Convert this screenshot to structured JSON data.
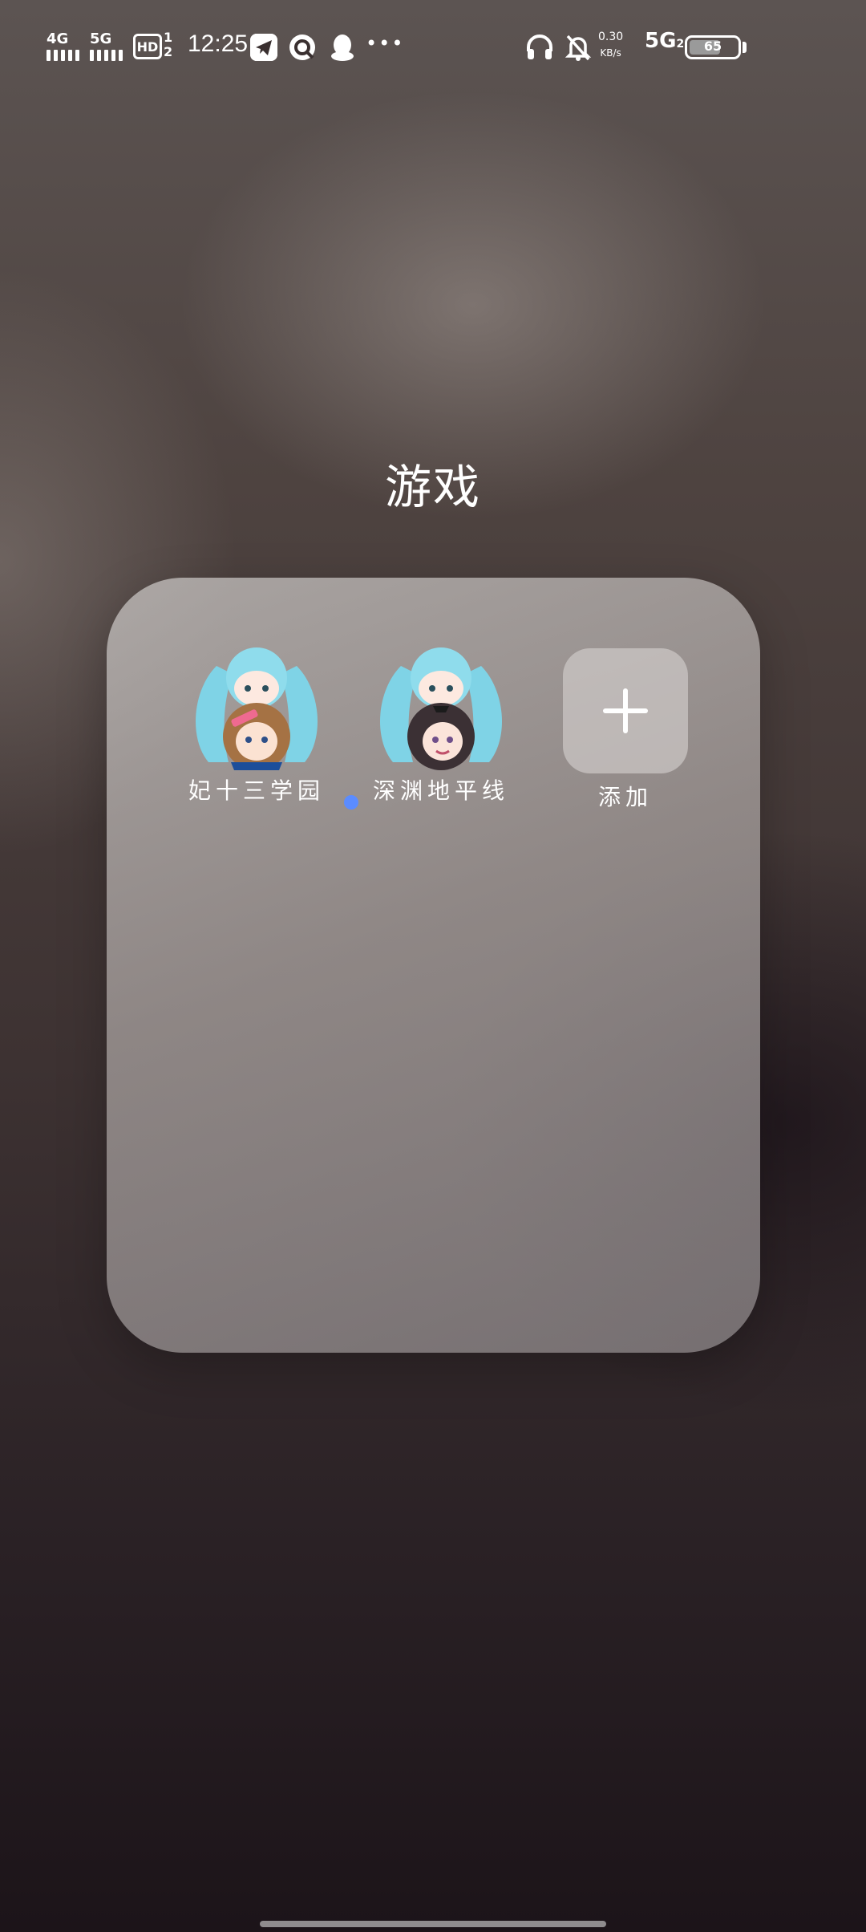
{
  "status_bar": {
    "sim1_network": "4G",
    "sim2_network": "5G",
    "hd_badge": "HD",
    "hd_numbers": "1\n2",
    "time": "12:25",
    "net_speed_value": "0.30",
    "net_speed_unit": "KB/s",
    "data_network": "5G",
    "data_network_sub": "2",
    "battery_level": "65",
    "more_icon": "•••",
    "icons": [
      "telegram-icon",
      "qq-browser-icon",
      "qq-icon",
      "more-icon",
      "headphones-icon",
      "muted-bell-icon"
    ]
  },
  "folder": {
    "title": "游戏",
    "apps": [
      {
        "label": "妃十三学园",
        "has_new_dot": false
      },
      {
        "label": "深渊地平线",
        "has_new_dot": true
      },
      {
        "label": "添加",
        "has_new_dot": false
      }
    ]
  }
}
